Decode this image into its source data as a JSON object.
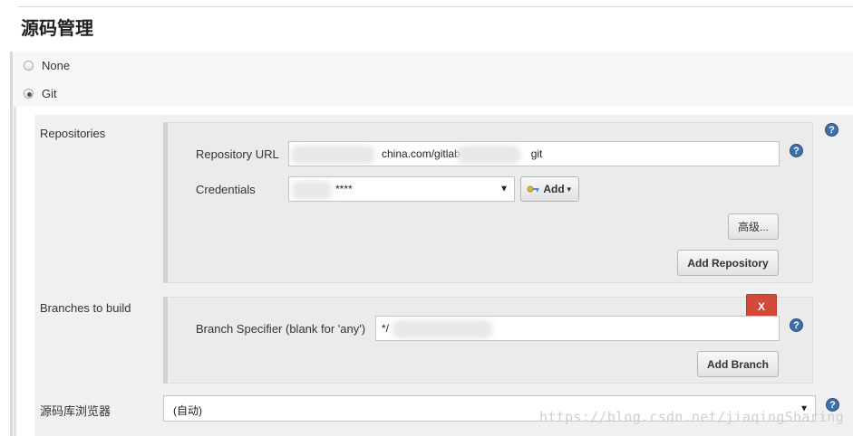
{
  "section": {
    "title": "源码管理"
  },
  "scm_options": [
    {
      "label": "None",
      "selected": false
    },
    {
      "label": "Git",
      "selected": true
    }
  ],
  "repositories": {
    "label": "Repositories",
    "url_label": "Repository URL",
    "url_value": "china.com/gitlab",
    "url_value_suffix": "git",
    "credentials_label": "Credentials",
    "credentials_value": "****",
    "add_label": "Add",
    "advanced_label": "高级...",
    "add_repository_label": "Add Repository"
  },
  "branches": {
    "label": "Branches to build",
    "delete_label": "X",
    "specifier_label": "Branch Specifier (blank for 'any')",
    "specifier_value": "*/",
    "add_branch_label": "Add Branch"
  },
  "repo_browser": {
    "label": "源码库浏览器",
    "value": "(自动)"
  },
  "help_glyph": "?",
  "watermark": "https://blog.csdn.net/jiaqingSharing",
  "colors": {
    "help": "#3f6ea8",
    "delete": "#d24939"
  }
}
